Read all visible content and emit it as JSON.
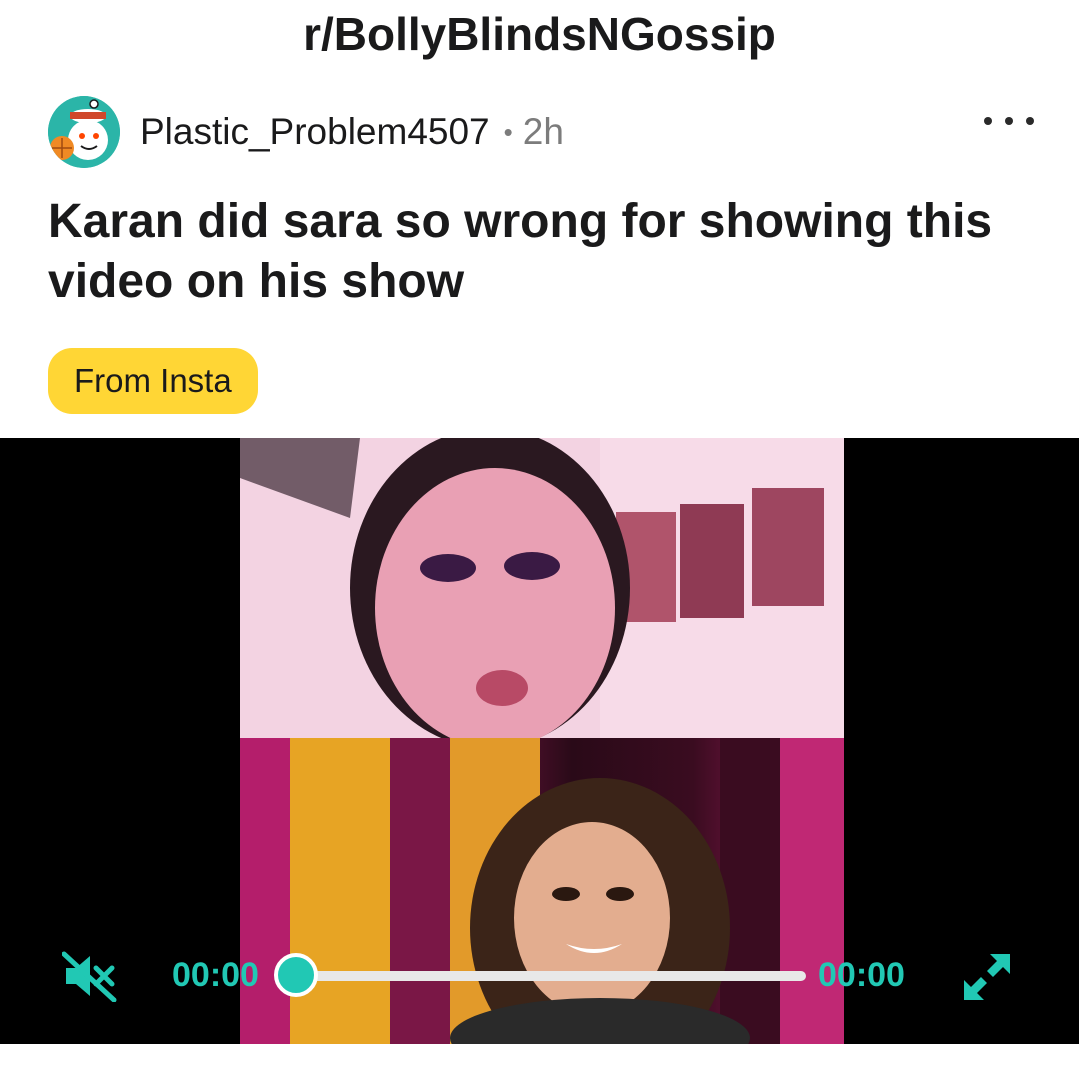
{
  "subreddit": "r/BollyBlindsNGossip",
  "post": {
    "username": "Plastic_Problem4507",
    "separator": "•",
    "age": "2h",
    "title": "Karan did sara so wrong for showing this video on his show",
    "flair": "From Insta",
    "flair_color": "#ffd635"
  },
  "video": {
    "current_time": "00:00",
    "duration": "00:00",
    "progress": 0,
    "muted": true,
    "accent_color": "#21c8b4"
  },
  "icons": {
    "avatar": "snoo-avatar-icon",
    "more": "more-options-icon",
    "mute": "volume-muted-icon",
    "fullscreen": "fullscreen-expand-icon"
  }
}
